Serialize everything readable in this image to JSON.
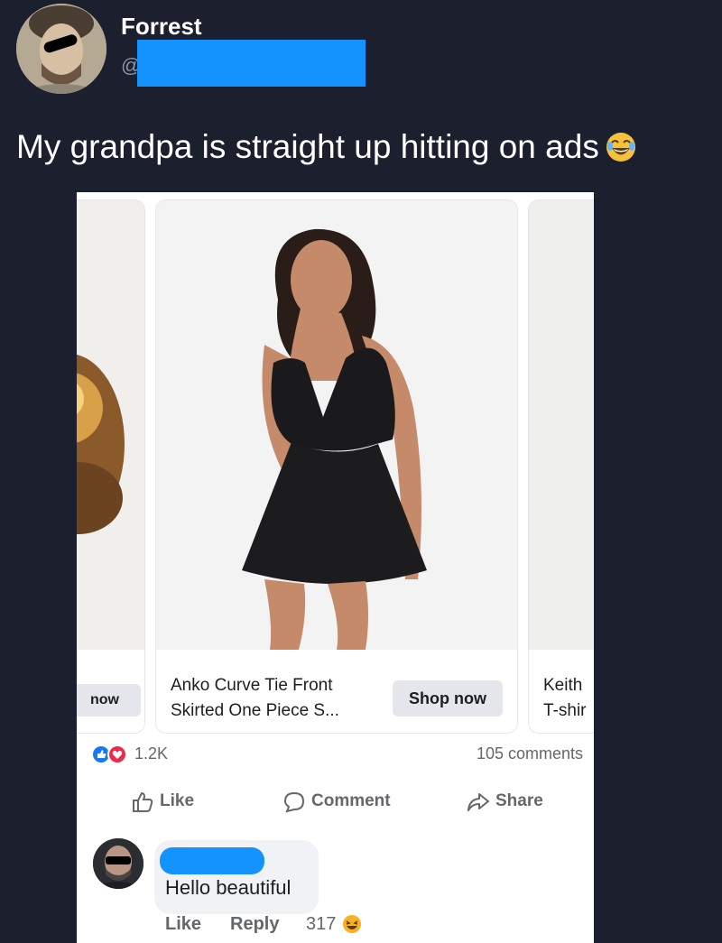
{
  "tweet": {
    "display_name": "Forrest",
    "handle_prefix": "@",
    "text": "My grandpa is straight up hitting on ads",
    "emoji": "laughing-emoji"
  },
  "ad": {
    "left_card": {
      "button_label": "now"
    },
    "main_card": {
      "title": "Anko Curve Tie Front Skirted One Piece S...",
      "button_label": "Shop now"
    },
    "right_card": {
      "title_line1": "Keith",
      "title_line2": "T-shir"
    },
    "reactions": {
      "count": "1.2K",
      "comments": "105 comments",
      "icons": [
        "like-reaction-icon",
        "love-reaction-icon"
      ]
    },
    "actions": {
      "like": "Like",
      "comment": "Comment",
      "share": "Share"
    },
    "comment": {
      "text": "Hello beautiful",
      "like": "Like",
      "reply": "Reply",
      "reaction_count": "317"
    }
  },
  "colors": {
    "background": "#1b1f2e",
    "redaction": "#1493ff",
    "fb_blue": "#1877f2",
    "love_red": "#f02849"
  }
}
